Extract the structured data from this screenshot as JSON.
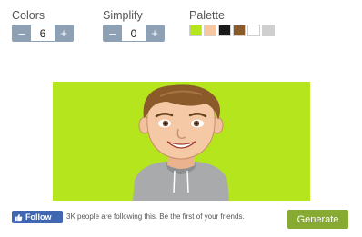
{
  "colors": {
    "label": "Colors",
    "minus": "–",
    "value": "6",
    "plus": "+"
  },
  "simplify": {
    "label": "Simplify",
    "minus": "–",
    "value": "0",
    "plus": "+"
  },
  "palette": {
    "label": "Palette",
    "swatches": [
      "#b5e61d",
      "#f8c7a0",
      "#1a1a1a",
      "#8a5a2b",
      "#ffffff",
      "#cfcfcf"
    ]
  },
  "preview": {
    "background": "#b5e61d"
  },
  "social": {
    "follow_label": "Follow",
    "text": "3K people are following this. Be the first of your friends."
  },
  "generate_label": "Generate",
  "icons": {
    "thumbs_up": "thumbs-up-icon"
  }
}
